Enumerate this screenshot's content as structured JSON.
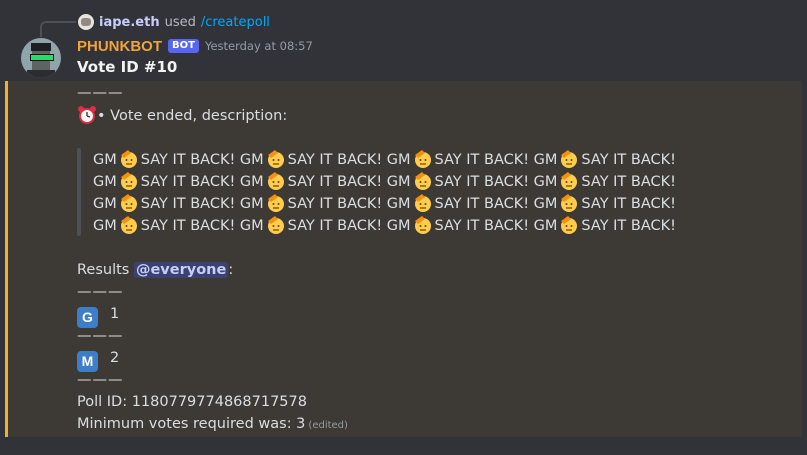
{
  "reply": {
    "user": "iape.eth",
    "used": "used",
    "command": "/createpoll"
  },
  "message": {
    "author": "PHUNKBOT",
    "bot_tag": "BOT",
    "timestamp": "Yesterday at 08:57",
    "title": "Vote ID #10"
  },
  "embed": {
    "accent_color": "#f0b132",
    "separator": "———",
    "status_text": "• Vote ended, description:",
    "description_lines": [
      [
        "GM",
        "SAY IT BACK! GM",
        "SAY IT BACK! GM",
        "SAY IT BACK! GM",
        "SAY IT BACK!"
      ],
      [
        "GM",
        "SAY IT BACK! GM",
        "SAY IT BACK! GM",
        "SAY IT BACK! GM",
        "SAY IT BACK!"
      ],
      [
        "GM",
        "SAY IT BACK! GM",
        "SAY IT BACK! GM",
        "SAY IT BACK! GM",
        "SAY IT BACK!"
      ],
      [
        "GM",
        "SAY IT BACK! GM",
        "SAY IT BACK! GM",
        "SAY IT BACK! GM",
        "SAY IT BACK!"
      ]
    ],
    "results_label": "Results",
    "mention": "@everyone",
    "results_colon": ":",
    "results": [
      {
        "icon": "G",
        "count": "1"
      },
      {
        "icon": "M",
        "count": "2"
      }
    ],
    "poll_id": "Poll ID: 1180779774868717578",
    "min_votes": "Minimum votes required was: 3",
    "edited": "(edited)"
  },
  "icons": {
    "alarm": "alarm-clock-icon",
    "salute": "saluting-face-icon",
    "letter_g": "letter-g-icon",
    "letter_m": "letter-m-icon"
  }
}
